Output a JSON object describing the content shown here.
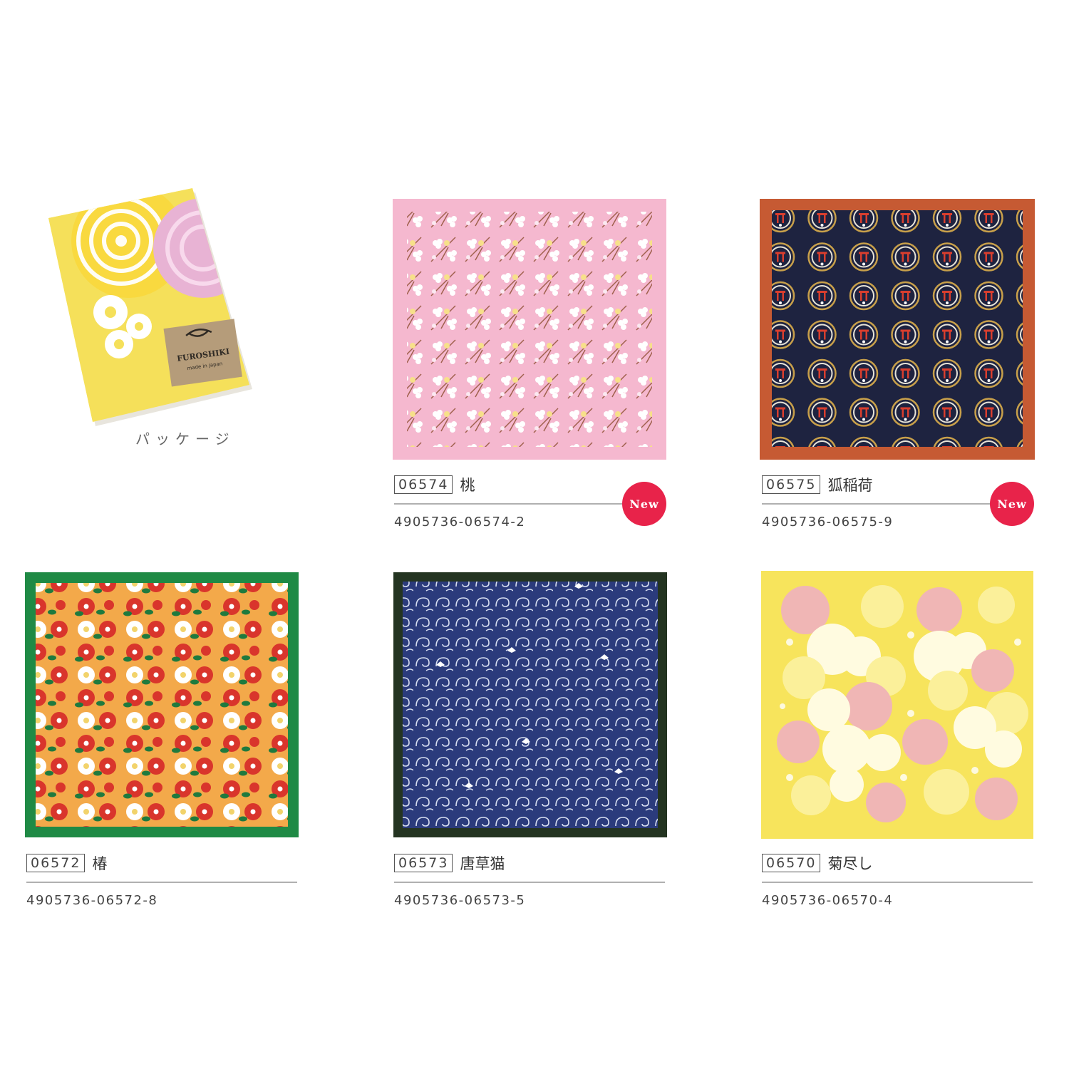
{
  "package": {
    "caption": "パッケージ",
    "label_text": "FUROSHIKI",
    "label_subtext": "made in japan"
  },
  "products": [
    {
      "code": "06574",
      "name": "桃",
      "jan": "4905736-06574-2",
      "badge": "New"
    },
    {
      "code": "06575",
      "name": "狐稲荷",
      "jan": "4905736-06575-9",
      "badge": "New"
    },
    {
      "code": "06572",
      "name": "椿",
      "jan": "4905736-06572-8"
    },
    {
      "code": "06573",
      "name": "唐草猫",
      "jan": "4905736-06573-5"
    },
    {
      "code": "06570",
      "name": "菊尽し",
      "jan": "4905736-06570-4"
    }
  ],
  "colors": {
    "peach_bg": "#f5b8cf",
    "inari_bg": "#1e2340",
    "inari_border": "#c65a33",
    "tsubaki_bg": "#f3a94a",
    "tsubaki_border": "#1f8a45",
    "karakusa_bg": "#2b3b7c",
    "karakusa_border": "#243421",
    "kiku_bg": "#f7e45c",
    "badge": "#e8234a"
  }
}
